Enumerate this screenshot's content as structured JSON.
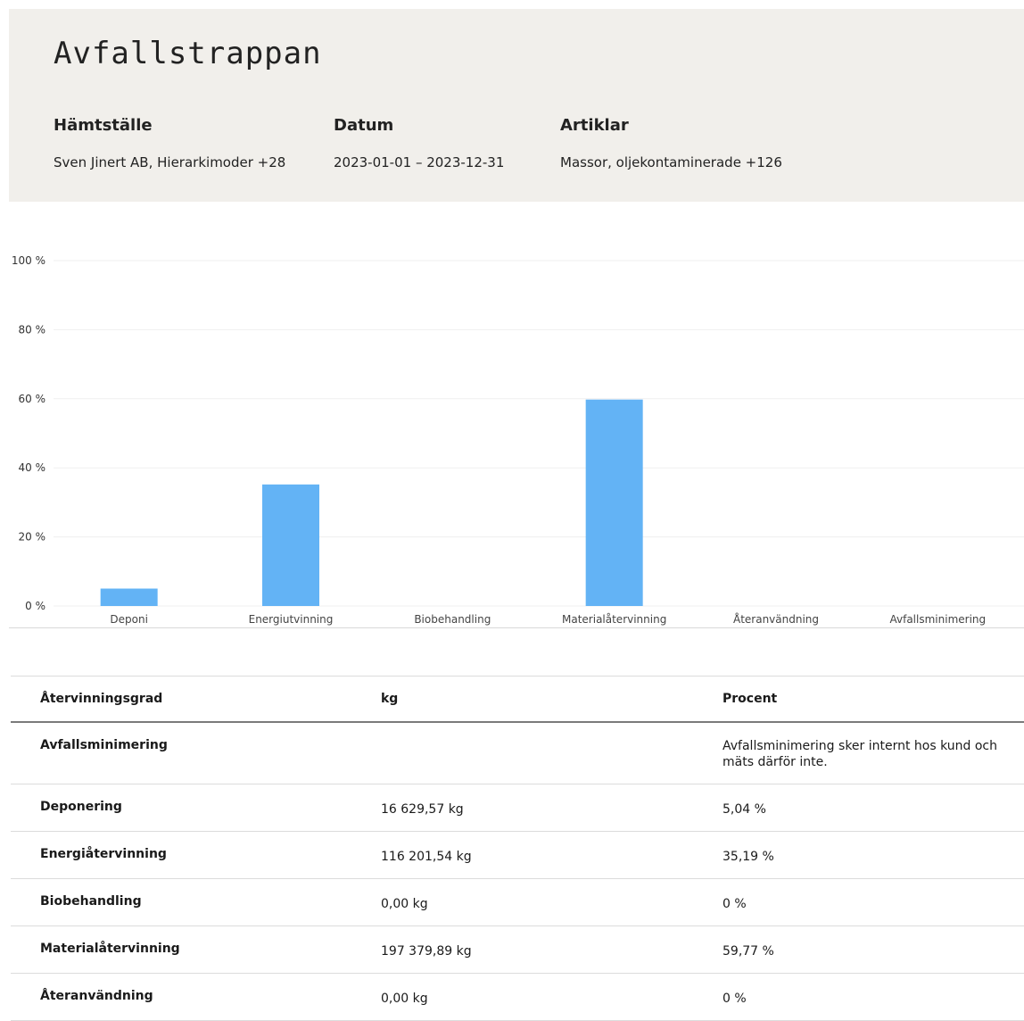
{
  "header": {
    "title": "Avfallstrappan",
    "filters": [
      {
        "label": "Hämtställe",
        "value": "Sven Jinert AB, Hierarkimoder +28"
      },
      {
        "label": "Datum",
        "value": "2023-01-01 – 2023-12-31"
      },
      {
        "label": "Artiklar",
        "value": "Massor, oljekontaminerade +126"
      }
    ]
  },
  "chart_data": {
    "type": "bar",
    "categories": [
      "Deponi",
      "Energiutvinning",
      "Biobehandling",
      "Materialåtervinning",
      "Återanvändning",
      "Avfallsminimering"
    ],
    "values": [
      5.04,
      35.19,
      0,
      59.77,
      0,
      0
    ],
    "yticks": [
      "0 %",
      "20 %",
      "40 %",
      "60 %",
      "80 %",
      "100 %"
    ],
    "ylim": [
      0,
      100
    ],
    "grid": true,
    "colors": {
      "bar": "#63b3f5"
    }
  },
  "table": {
    "headers": [
      "Återvinningsgrad",
      "kg",
      "Procent"
    ],
    "rows": [
      [
        "Avfallsminimering",
        "",
        "Avfallsminimering sker internt hos kund och mäts därför inte."
      ],
      [
        "Deponering",
        "16 629,57 kg",
        "5,04 %"
      ],
      [
        "Energiåtervinning",
        "116 201,54 kg",
        "35,19 %"
      ],
      [
        "Biobehandling",
        "0,00 kg",
        "0 %"
      ],
      [
        "Materialåtervinning",
        "197 379,89 kg",
        "59,77 %"
      ],
      [
        "Återanvändning",
        "0,00 kg",
        "0 %"
      ]
    ]
  }
}
